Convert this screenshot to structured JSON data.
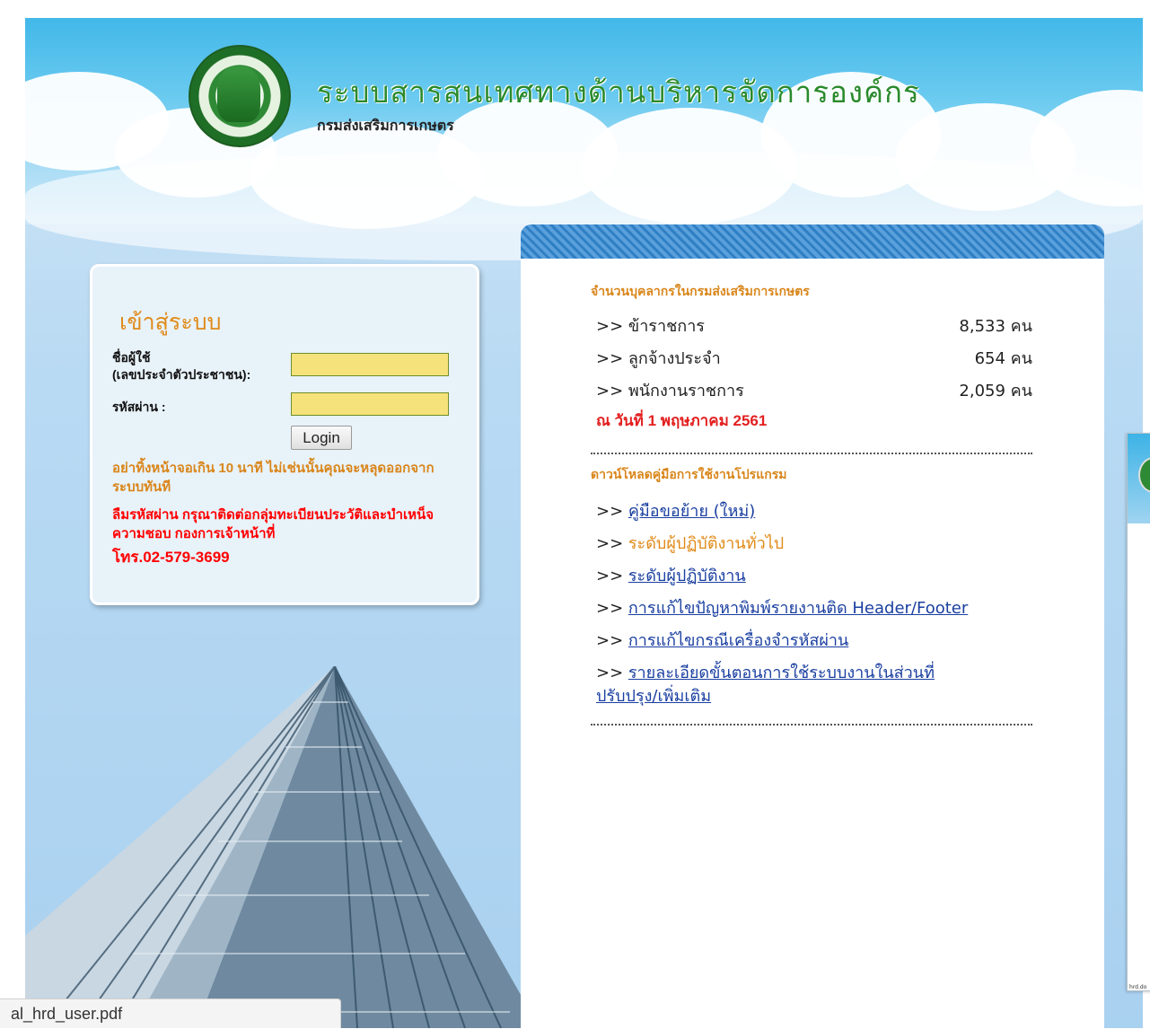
{
  "header": {
    "title": "ระบบสารสนเทศทางด้านบริหารจัดการองค์กร",
    "subtitle": "กรมส่งเสริมการเกษตร"
  },
  "login": {
    "title": "เข้าสู่ระบบ",
    "username_label_line1": "ชื่อผู้ใช้",
    "username_label_line2": "(เลขประจำตัวประชาชน):",
    "username_value": "",
    "password_label": "รหัสผ่าน :",
    "password_value": "",
    "button_label": "Login",
    "timeout_warning": "อย่าทิ้งหน้าจอเกิน 10 นาที ไม่เช่นนั้นคุณจะหลุดออกจากระบบทันที",
    "contact_note": "ลืมรหัสผ่าน กรุณาติดต่อกลุ่มทะเบียนประวัติและบำเหน็จความชอบ กองการเจ้าหน้าที่",
    "contact_phone": "โทร.02-579-3699"
  },
  "stats": {
    "title": "จำนวนบุคลากรในกรมส่งเสริมการเกษตร",
    "rows": [
      {
        "label": ">> ข้าราชการ",
        "value": "8,533 คน"
      },
      {
        "label": ">> ลูกจ้างประจำ",
        "value": "654 คน"
      },
      {
        "label": ">> พนักงานราชการ",
        "value": "2,059 คน"
      }
    ],
    "as_of": "ณ วันที่  1 พฤษภาคม 2561"
  },
  "downloads": {
    "title": "ดาวน์โหลดคู่มือการใช้งานโปรแกรม",
    "prefix": ">> ",
    "items": [
      {
        "label": "คู่มือขอย้าย (ใหม่)"
      },
      {
        "label": "ระดับผู้ปฏิบัติงานทั่วไป"
      },
      {
        "label": "ระดับผู้ปฏิบัติงาน"
      },
      {
        "label": "การแก้ไขปัญหาพิมพ์รายงานติด Header/Footer"
      },
      {
        "label": "การแก้ไขกรณีเครื่องจำรหัสผ่าน"
      },
      {
        "label": "รายละเอียดขั้นตอนการใช้ระบบงานในส่วนที่",
        "label_line2": "ปรับปรุง/เพิ่มเติม"
      }
    ]
  },
  "status_bar": {
    "text": "al_hrd_user.pdf"
  },
  "side_thumbnail": {
    "caption": "hrd.do"
  },
  "colors": {
    "header_sky": "#42b8e9",
    "title_green": "#2a8a2c",
    "section_orange": "#d9861b",
    "alert_red": "#ff0000",
    "link_blue": "#1a3fa0",
    "stripe_blue": "#2f7fc4",
    "input_yellow": "#f5e27a"
  }
}
